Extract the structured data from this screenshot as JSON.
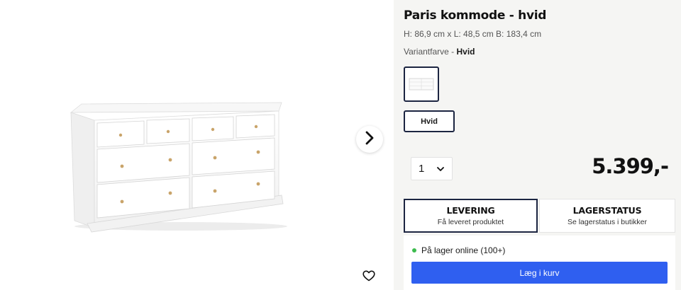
{
  "product": {
    "title": "Paris kommode - hvid",
    "dimensions": "H: 86,9 cm x L: 48,5 cm B: 183,4 cm",
    "variant_prefix": "Variantfarve - ",
    "variant_value": "Hvid",
    "variant_option_label": "Hvid",
    "quantity": "1",
    "price": "5.399,-"
  },
  "tabs": {
    "delivery": {
      "title": "LEVERING",
      "subtitle": "Få leveret produktet"
    },
    "stock": {
      "title": "LAGERSTATUS",
      "subtitle": "Se lagerstatus i butikker"
    }
  },
  "stock": {
    "status": "På lager online (100+)",
    "status_color": "#3dbb4e"
  },
  "cart": {
    "label": "Læg i kurv"
  },
  "colors": {
    "accent": "#2f5ff0",
    "selected_border": "#1c2541",
    "panel_bg": "#f5f5f3"
  },
  "icons": {
    "next": "chevron-right-icon",
    "favorite": "heart-icon",
    "dropdown": "chevron-down-icon"
  }
}
